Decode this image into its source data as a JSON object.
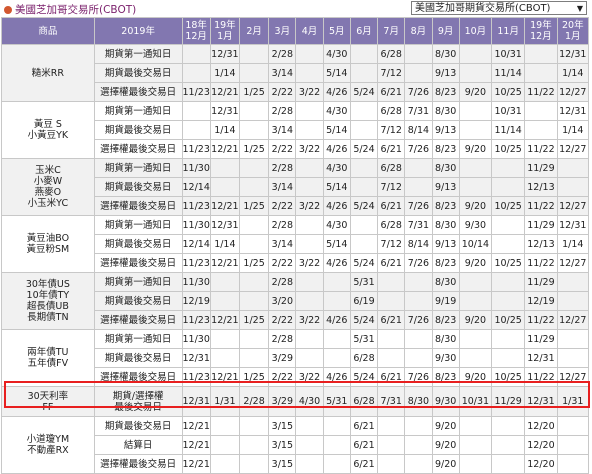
{
  "header": {
    "title": "美國芝加哥交易所(CBOT)",
    "exchange_select": "美國芝加哥期貨交易所(CBOT)"
  },
  "table": {
    "columns": [
      "商品",
      "2019年",
      "18年 12月",
      "19年 1月",
      "2月",
      "3月",
      "4月",
      "5月",
      "6月",
      "7月",
      "8月",
      "9月",
      "10月",
      "11月",
      "19年 12月",
      "20年 1月"
    ],
    "groups": [
      {
        "products": "糙米RR",
        "shade": 0,
        "rows": [
          {
            "label": "期貨第一通知日",
            "cells": [
              "",
              "12/31",
              "",
              "2/28",
              "",
              "4/30",
              "",
              "6/28",
              "",
              "8/30",
              "",
              "10/31",
              "",
              "12/31"
            ]
          },
          {
            "label": "期貨最後交易日",
            "cells": [
              "",
              "1/14",
              "",
              "3/14",
              "",
              "5/14",
              "",
              "7/12",
              "",
              "9/13",
              "",
              "11/14",
              "",
              "1/14"
            ]
          },
          {
            "label": "選擇權最後交易日",
            "cells": [
              "11/23",
              "12/21",
              "1/25",
              "2/22",
              "3/22",
              "4/26",
              "5/24",
              "6/21",
              "7/26",
              "8/23",
              "9/20",
              "10/25",
              "11/22",
              "12/27"
            ]
          }
        ]
      },
      {
        "products": "黃豆 S\n小黃豆YK",
        "shade": 1,
        "rows": [
          {
            "label": "期貨第一通知日",
            "cells": [
              "",
              "12/31",
              "",
              "2/28",
              "",
              "4/30",
              "",
              "6/28",
              "7/31",
              "8/30",
              "",
              "10/31",
              "",
              "12/31"
            ]
          },
          {
            "label": "期貨最後交易日",
            "cells": [
              "",
              "1/14",
              "",
              "3/14",
              "",
              "5/14",
              "",
              "7/12",
              "8/14",
              "9/13",
              "",
              "11/14",
              "",
              "1/14"
            ]
          },
          {
            "label": "選擇權最後交易日",
            "cells": [
              "11/23",
              "12/21",
              "1/25",
              "2/22",
              "3/22",
              "4/26",
              "5/24",
              "6/21",
              "7/26",
              "8/23",
              "9/20",
              "10/25",
              "11/22",
              "12/27"
            ]
          }
        ]
      },
      {
        "products": "玉米C\n小麥W\n燕麥O\n小玉米YC",
        "shade": 0,
        "rows": [
          {
            "label": "期貨第一通知日",
            "cells": [
              "11/30",
              "",
              "",
              "2/28",
              "",
              "4/30",
              "",
              "6/28",
              "",
              "8/30",
              "",
              "",
              "11/29",
              ""
            ]
          },
          {
            "label": "期貨最後交易日",
            "cells": [
              "12/14",
              "",
              "",
              "3/14",
              "",
              "5/14",
              "",
              "7/12",
              "",
              "9/13",
              "",
              "",
              "12/13",
              ""
            ]
          },
          {
            "label": "選擇權最後交易日",
            "cells": [
              "11/23",
              "12/21",
              "1/25",
              "2/22",
              "3/22",
              "4/26",
              "5/24",
              "6/21",
              "7/26",
              "8/23",
              "9/20",
              "10/25",
              "11/22",
              "12/27"
            ]
          }
        ]
      },
      {
        "products": "黃豆油BO\n黃豆粉SM",
        "shade": 1,
        "rows": [
          {
            "label": "期貨第一通知日",
            "cells": [
              "11/30",
              "12/31",
              "",
              "2/28",
              "",
              "4/30",
              "",
              "6/28",
              "7/31",
              "8/30",
              "9/30",
              "",
              "11/29",
              "12/31"
            ]
          },
          {
            "label": "期貨最後交易日",
            "cells": [
              "12/14",
              "1/14",
              "",
              "3/14",
              "",
              "5/14",
              "",
              "7/12",
              "8/14",
              "9/13",
              "10/14",
              "",
              "12/13",
              "1/14"
            ]
          },
          {
            "label": "選擇權最後交易日",
            "cells": [
              "11/23",
              "12/21",
              "1/25",
              "2/22",
              "3/22",
              "4/26",
              "5/24",
              "6/21",
              "7/26",
              "8/23",
              "9/20",
              "10/25",
              "11/22",
              "12/27"
            ]
          }
        ]
      },
      {
        "products": "30年債US\n10年債TY\n超長債UB\n長期債TN",
        "shade": 0,
        "rows": [
          {
            "label": "期貨第一通知日",
            "cells": [
              "11/30",
              "",
              "",
              "2/28",
              "",
              "",
              "5/31",
              "",
              "",
              "8/30",
              "",
              "",
              "11/29",
              ""
            ]
          },
          {
            "label": "期貨最後交易日",
            "cells": [
              "12/19",
              "",
              "",
              "3/20",
              "",
              "",
              "6/19",
              "",
              "",
              "9/19",
              "",
              "",
              "12/19",
              ""
            ]
          },
          {
            "label": "選擇權最後交易日",
            "cells": [
              "11/23",
              "12/21",
              "1/25",
              "2/22",
              "3/22",
              "4/26",
              "5/24",
              "6/21",
              "7/26",
              "8/23",
              "9/20",
              "10/25",
              "11/22",
              "12/27"
            ]
          }
        ]
      },
      {
        "products": "兩年債TU\n五年債FV",
        "shade": 1,
        "rows": [
          {
            "label": "期貨第一通知日",
            "cells": [
              "11/30",
              "",
              "",
              "2/28",
              "",
              "",
              "5/31",
              "",
              "",
              "8/30",
              "",
              "",
              "11/29",
              ""
            ]
          },
          {
            "label": "期貨最後交易日",
            "cells": [
              "12/31",
              "",
              "",
              "3/29",
              "",
              "",
              "6/28",
              "",
              "",
              "9/30",
              "",
              "",
              "12/31",
              ""
            ]
          },
          {
            "label": "選擇權最後交易日",
            "cells": [
              "11/23",
              "12/21",
              "1/25",
              "2/22",
              "3/22",
              "4/26",
              "5/24",
              "6/21",
              "7/26",
              "8/23",
              "9/20",
              "10/25",
              "11/22",
              "12/27"
            ]
          }
        ]
      },
      {
        "products": "30天利率\nFF",
        "shade": 0,
        "rows": [
          {
            "label": "期貨/選擇權\n最後交易日",
            "cells": [
              "12/31",
              "1/31",
              "2/28",
              "3/29",
              "4/30",
              "5/31",
              "6/28",
              "7/31",
              "8/30",
              "9/30",
              "10/31",
              "11/29",
              "12/31",
              "1/31"
            ]
          }
        ]
      },
      {
        "products": "小道瓊YM\n不動產RX",
        "shade": 1,
        "rows": [
          {
            "label": "期貨最後交易日",
            "cells": [
              "12/21",
              "",
              "",
              "3/15",
              "",
              "",
              "6/21",
              "",
              "",
              "9/20",
              "",
              "",
              "12/20",
              ""
            ]
          },
          {
            "label": "結算日",
            "cells": [
              "12/21",
              "",
              "",
              "3/15",
              "",
              "",
              "6/21",
              "",
              "",
              "9/20",
              "",
              "",
              "12/20",
              ""
            ]
          },
          {
            "label": "選擇權最後交易日",
            "cells": [
              "12/21",
              "",
              "",
              "3/15",
              "",
              "",
              "6/21",
              "",
              "",
              "9/20",
              "",
              "",
              "12/20",
              ""
            ]
          }
        ]
      }
    ]
  },
  "highlight_color": "#e81f1f"
}
